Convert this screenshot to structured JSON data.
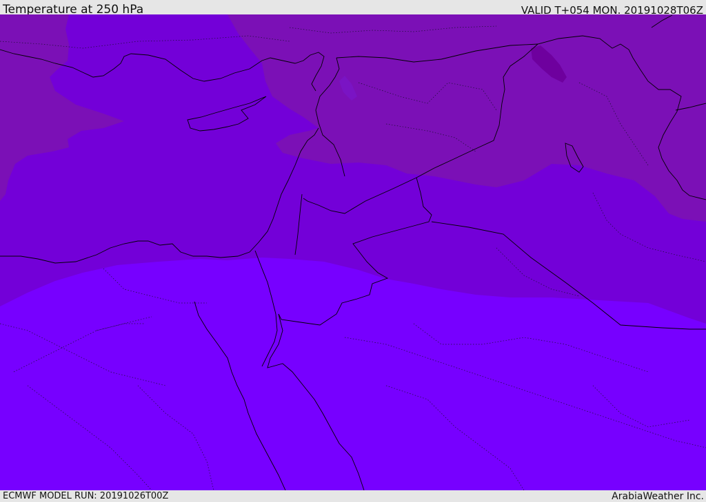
{
  "header": {
    "title": "Temperature at 250 hPa",
    "valid_time": "VALID T+054 MON. 20191028T06Z"
  },
  "footer": {
    "model_run": "ECMWF MODEL RUN: 20191026T00Z",
    "credit": "ArabiaWeather Inc."
  },
  "map": {
    "fill_colors": {
      "cold_core": "#6e009e",
      "cold": "#7b10b6",
      "mid": "#7300d8",
      "warm": "#7700ff"
    },
    "boundary_color": "#000000"
  }
}
